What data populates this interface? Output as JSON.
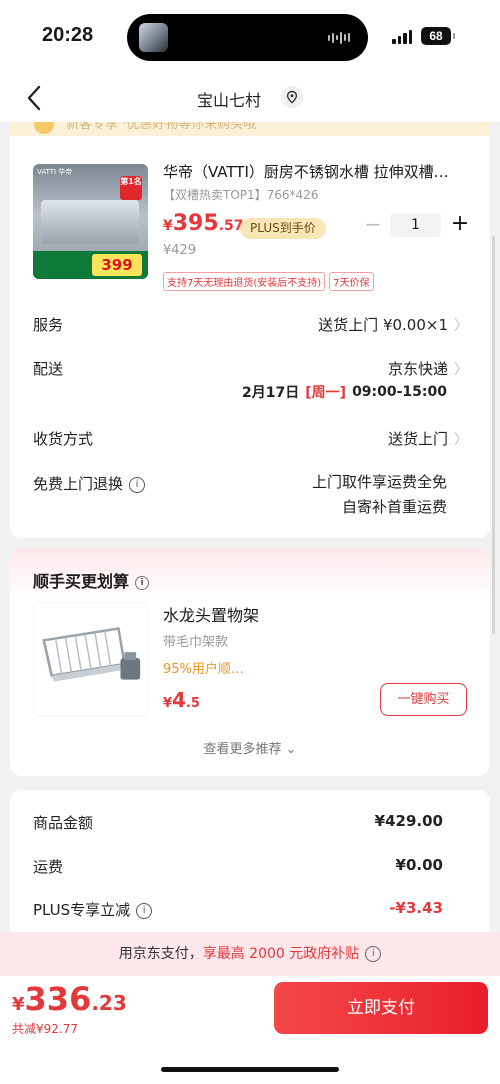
{
  "status_bar": {
    "time": "20:28",
    "battery": "68"
  },
  "navbar": {
    "title": "宝山七村"
  },
  "notice": {
    "text": "新客专享 ·优惠好物等你来购买哦"
  },
  "product": {
    "brand_badge": "VATTI 华帝",
    "rank_badge": "第1名",
    "promo_price": "399",
    "title": "华帝（VATTI）厨房不锈钢水槽 拉伸双槽…",
    "subtitle": "【双槽热卖TOP1】766*426",
    "price_currency": "¥",
    "price_int": "395",
    "price_dec": ".57",
    "plus_label": "PLUS到手价",
    "original_price": "¥429",
    "quantity": "1",
    "minus": "−",
    "plus": "+",
    "tags": [
      "支持7天无理由退货(安装后不支持)",
      "7天价保"
    ]
  },
  "rows": {
    "service": {
      "label": "服务",
      "value": "送货上门  ¥0.00×1"
    },
    "delivery": {
      "label": "配送",
      "value": "京东快递",
      "date": "2月17日",
      "weekday": "[周一]",
      "time_slot": "09:00-15:00"
    },
    "receive": {
      "label": "收货方式",
      "value": "送货上门"
    },
    "return": {
      "label": "免费上门退换",
      "line1": "上门取件享运费全免",
      "line2": "自寄补首重运费"
    }
  },
  "recommend": {
    "title": "顺手买更划算",
    "item_name": "水龙头置物架",
    "item_spec": "带毛巾架款",
    "item_rate": "95%用户顺…",
    "price_currency": "¥",
    "price_int": "4",
    "price_dec": ".5",
    "buy_label": "一键购买",
    "more_label": "查看更多推荐 ⌄"
  },
  "summary": {
    "goods_label": "商品金额",
    "goods_value": "¥429.00",
    "freight_label": "运费",
    "freight_value": "¥0.00",
    "plus_label": "PLUS专享立减",
    "plus_value": "-¥3.43"
  },
  "subsidy": {
    "prefix": "用京东支付，",
    "highlight": "享最高 2000 元政府补贴"
  },
  "bottom": {
    "total_currency": "¥",
    "total_int": "336",
    "total_dec": ".23",
    "saved": "共减¥92.77",
    "pay_label": "立即支付"
  },
  "colors": {
    "accent": "#e4393c",
    "plus_gold": "#f8e7b6",
    "subsidy_bg": "#fde7ea"
  }
}
